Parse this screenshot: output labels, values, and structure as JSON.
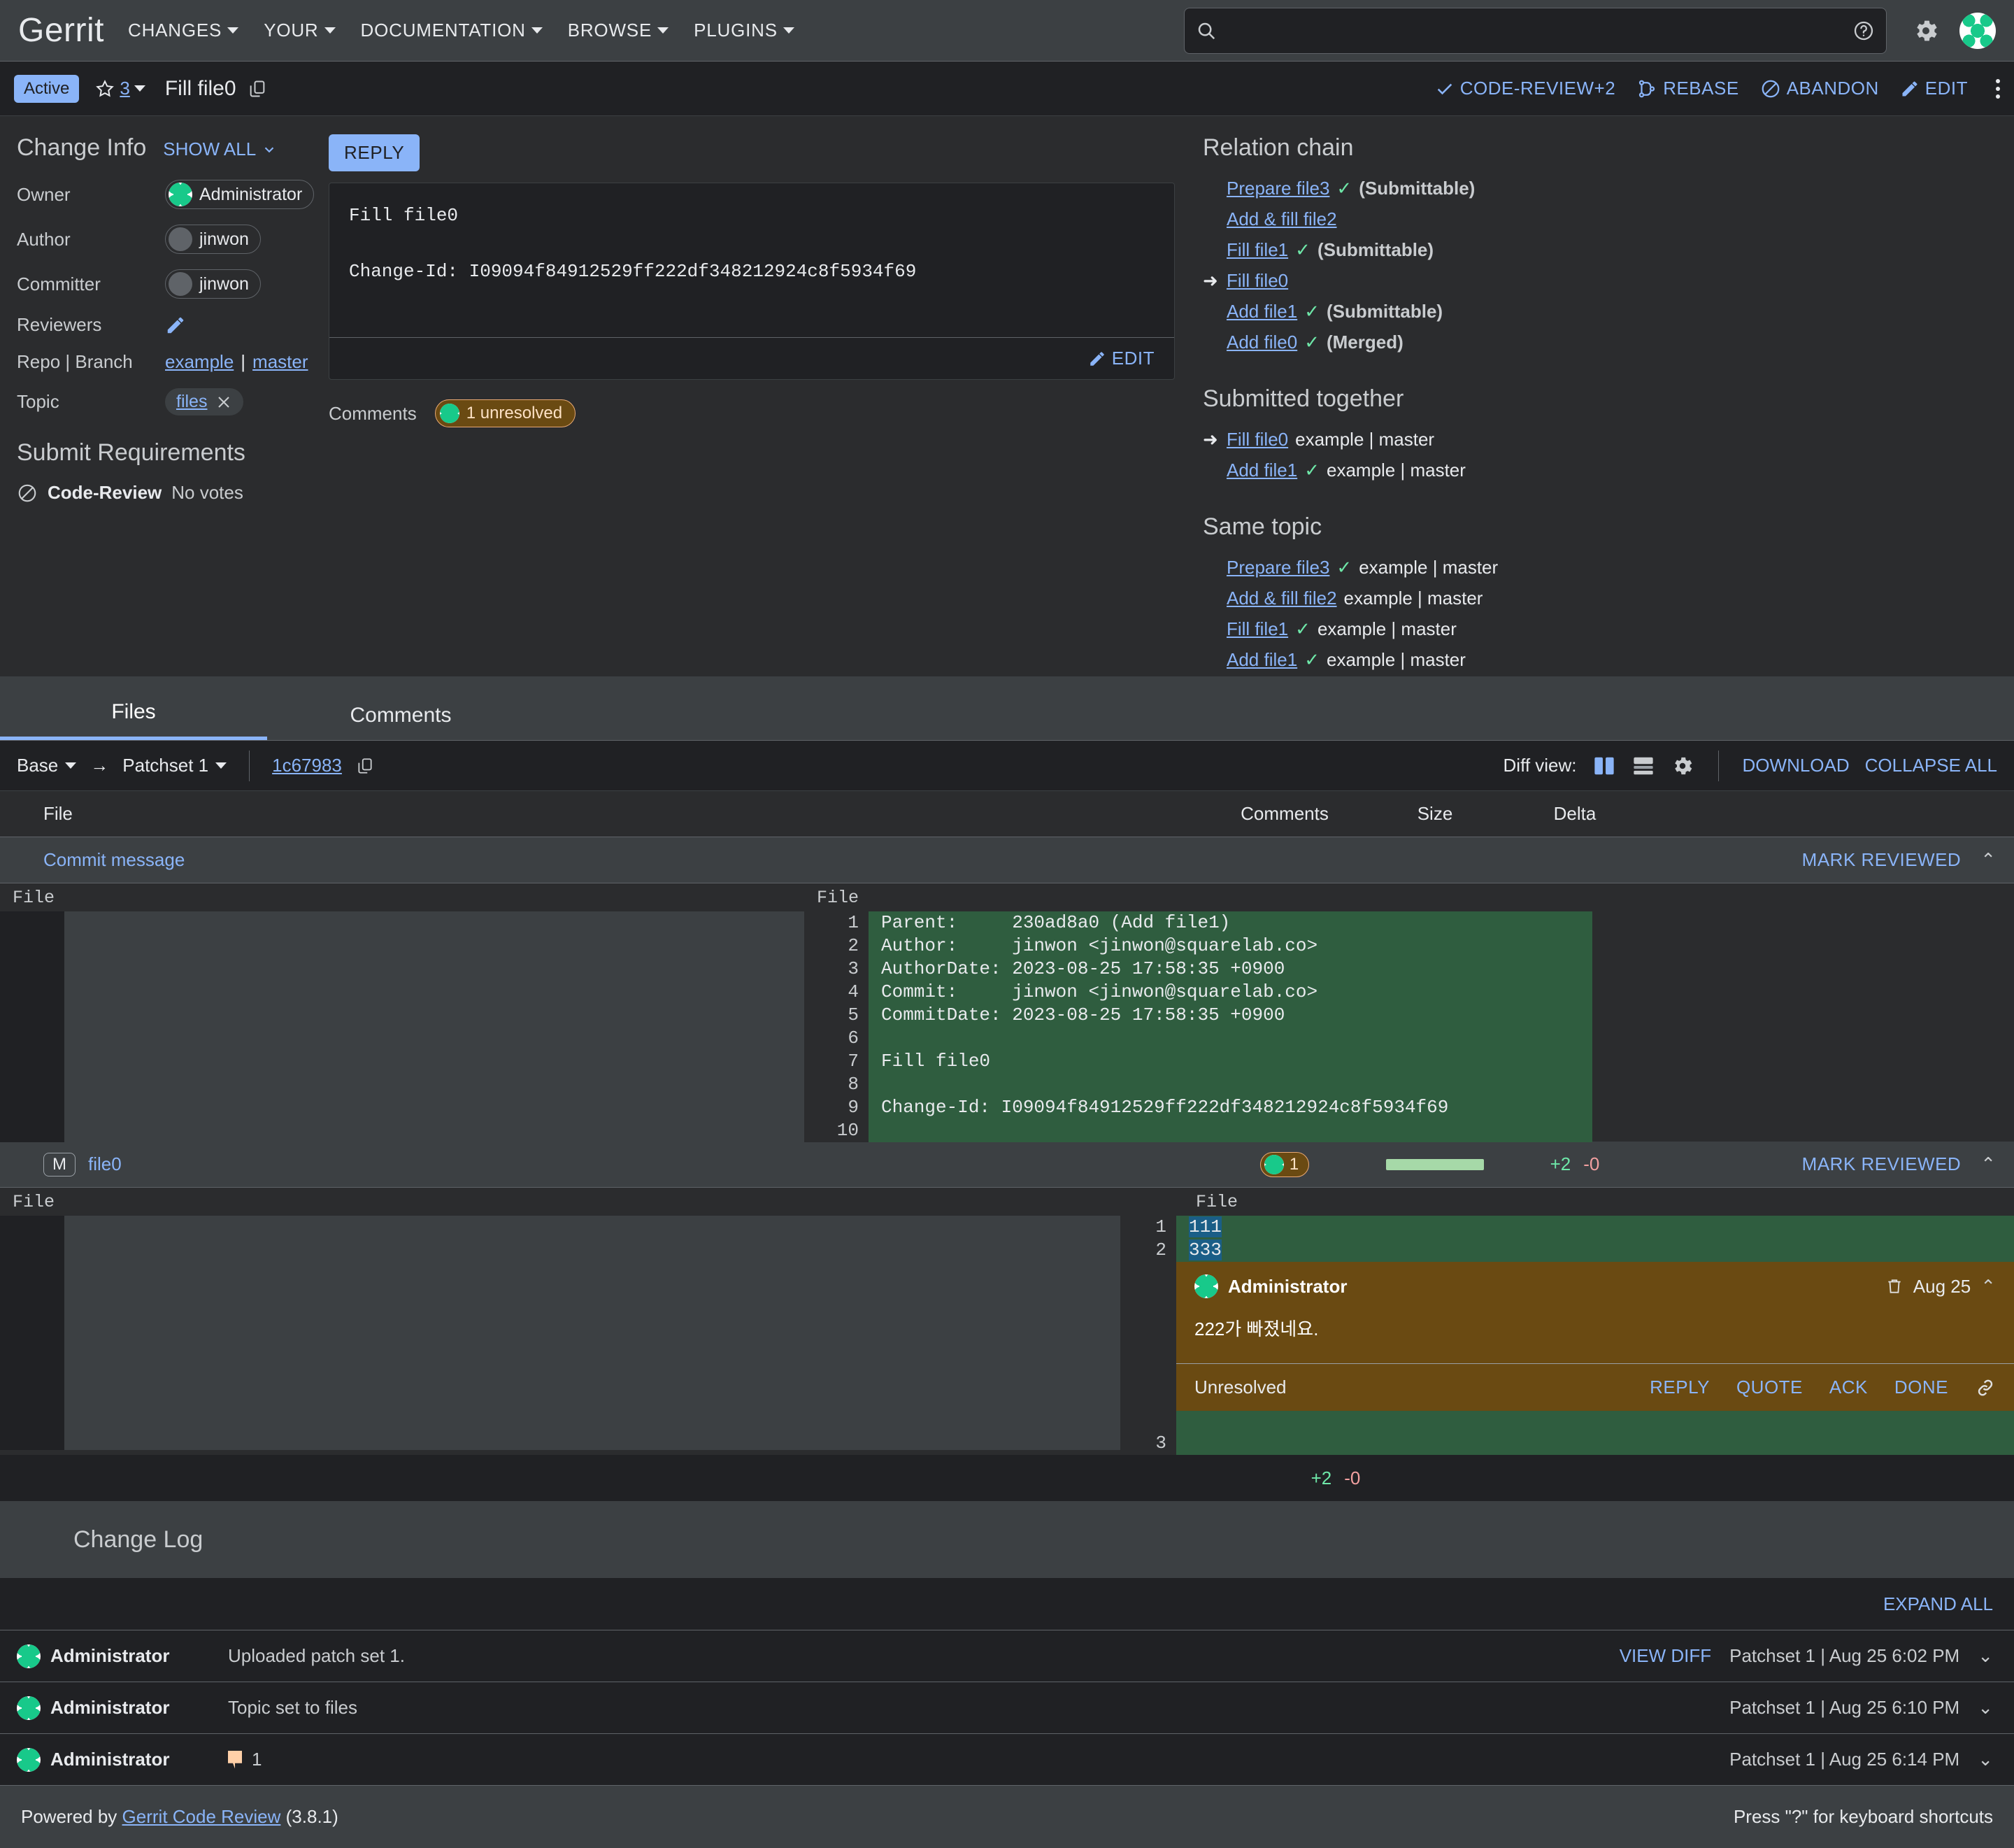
{
  "topnav": {
    "logo": "Gerrit",
    "items": [
      "CHANGES",
      "YOUR",
      "DOCUMENTATION",
      "BROWSE",
      "PLUGINS"
    ],
    "search_placeholder": ""
  },
  "change_header": {
    "status": "Active",
    "star_count": "3",
    "title": "Fill file0",
    "actions": [
      "CODE-REVIEW+2",
      "REBASE",
      "ABANDON",
      "EDIT"
    ]
  },
  "change_info": {
    "title": "Change Info",
    "show_all": "SHOW ALL",
    "owner_label": "Owner",
    "owner_value": "Administrator",
    "author_label": "Author",
    "author_value": "jinwon",
    "committer_label": "Committer",
    "committer_value": "jinwon",
    "reviewers_label": "Reviewers",
    "repo_branch_label": "Repo | Branch",
    "repo": "example",
    "branch": "master",
    "topic_label": "Topic",
    "topic_value": "files",
    "submit_req_title": "Submit Requirements",
    "submit_req_name": "Code-Review",
    "submit_req_value": "No votes"
  },
  "commit_panel": {
    "reply_label": "REPLY",
    "message": "Fill file0\n\nChange-Id: I09094f84912529ff222df348212924c8f5934f69",
    "edit_label": "EDIT",
    "comments_label": "Comments",
    "unresolved_label": "1 unresolved"
  },
  "relation_chain": {
    "title": "Relation chain",
    "items": [
      {
        "name": "Prepare file3",
        "check": true,
        "state": "(Submittable)",
        "current": false
      },
      {
        "name": "Add & fill file2",
        "check": false,
        "state": "",
        "current": false
      },
      {
        "name": "Fill file1",
        "check": true,
        "state": "(Submittable)",
        "current": false
      },
      {
        "name": "Fill file0",
        "check": false,
        "state": "",
        "current": true
      },
      {
        "name": "Add file1",
        "check": true,
        "state": "(Submittable)",
        "current": false
      },
      {
        "name": "Add file0",
        "check": true,
        "state": "(Merged)",
        "current": false
      }
    ]
  },
  "submitted_together": {
    "title": "Submitted together",
    "items": [
      {
        "name": "Fill file0",
        "check": false,
        "branch": "example | master",
        "current": true
      },
      {
        "name": "Add file1",
        "check": true,
        "branch": "example | master",
        "current": false
      }
    ]
  },
  "same_topic": {
    "title": "Same topic",
    "items": [
      {
        "name": "Prepare file3",
        "check": true,
        "branch": "example | master",
        "current": false
      },
      {
        "name": "Add & fill file2",
        "check": false,
        "branch": "example | master",
        "current": false
      },
      {
        "name": "Fill file1",
        "check": true,
        "branch": "example | master",
        "current": false
      },
      {
        "name": "Add file1",
        "check": true,
        "branch": "example | master",
        "current": false
      }
    ]
  },
  "tabs": {
    "files": "Files",
    "comments": "Comments"
  },
  "patchset_bar": {
    "base": "Base",
    "patchset": "Patchset 1",
    "commit_sha": "1c67983",
    "diff_view_label": "Diff view:",
    "download": "DOWNLOAD",
    "collapse_all": "COLLAPSE ALL"
  },
  "file_columns": {
    "file": "File",
    "comments": "Comments",
    "size": "Size",
    "delta": "Delta"
  },
  "commit_message_file": {
    "name": "Commit message",
    "mark_reviewed": "MARK REVIEWED",
    "left_header": "File",
    "right_header": "File",
    "lines": [
      {
        "n": "1",
        "text": "Parent:     230ad8a0 (Add file1)"
      },
      {
        "n": "2",
        "text": "Author:     jinwon <jinwon@squarelab.co>"
      },
      {
        "n": "3",
        "text": "AuthorDate: 2023-08-25 17:58:35 +0900"
      },
      {
        "n": "4",
        "text": "Commit:     jinwon <jinwon@squarelab.co>"
      },
      {
        "n": "5",
        "text": "CommitDate: 2023-08-25 17:58:35 +0900"
      },
      {
        "n": "6",
        "text": ""
      },
      {
        "n": "7",
        "text": "Fill file0"
      },
      {
        "n": "8",
        "text": ""
      },
      {
        "n": "9",
        "text": "Change-Id: I09094f84912529ff222df348212924c8f5934f69"
      },
      {
        "n": "10",
        "text": ""
      }
    ]
  },
  "file0": {
    "status_badge": "M",
    "name": "file0",
    "comment_count": "1",
    "added": "+2",
    "removed": "-0",
    "mark_reviewed": "MARK REVIEWED",
    "left_header": "File",
    "right_header": "File",
    "lines": [
      {
        "n": "1",
        "text": "111"
      },
      {
        "n": "2",
        "text": "333"
      },
      {
        "n": "3",
        "text": ""
      }
    ],
    "total_added": "+2",
    "total_removed": "-0",
    "comment": {
      "author": "Administrator",
      "date": "Aug 25",
      "body": "222가 빠졌네요.",
      "status": "Unresolved",
      "actions": [
        "REPLY",
        "QUOTE",
        "ACK",
        "DONE"
      ]
    }
  },
  "change_log": {
    "title": "Change Log",
    "expand_all": "EXPAND ALL",
    "rows": [
      {
        "who": "Administrator",
        "message": "Uploaded patch set 1.",
        "flag": false,
        "view_diff": "VIEW DIFF",
        "meta": "Patchset 1 | Aug 25 6:02 PM"
      },
      {
        "who": "Administrator",
        "message": "Topic set to files",
        "flag": false,
        "view_diff": "",
        "meta": "Patchset 1 | Aug 25 6:10 PM"
      },
      {
        "who": "Administrator",
        "message": "1",
        "flag": true,
        "view_diff": "",
        "meta": "Patchset 1 | Aug 25 6:14 PM"
      }
    ]
  },
  "footer": {
    "powered_by": "Powered by",
    "link": "Gerrit Code Review",
    "version": "(3.8.1)",
    "shortcuts": "Press \"?\" for keyboard shortcuts"
  },
  "colors": {
    "accent": "#8ab4f8",
    "added": "#2f5d3f",
    "comment": "#6a4a12",
    "status_chip": "#8ab4f8"
  }
}
